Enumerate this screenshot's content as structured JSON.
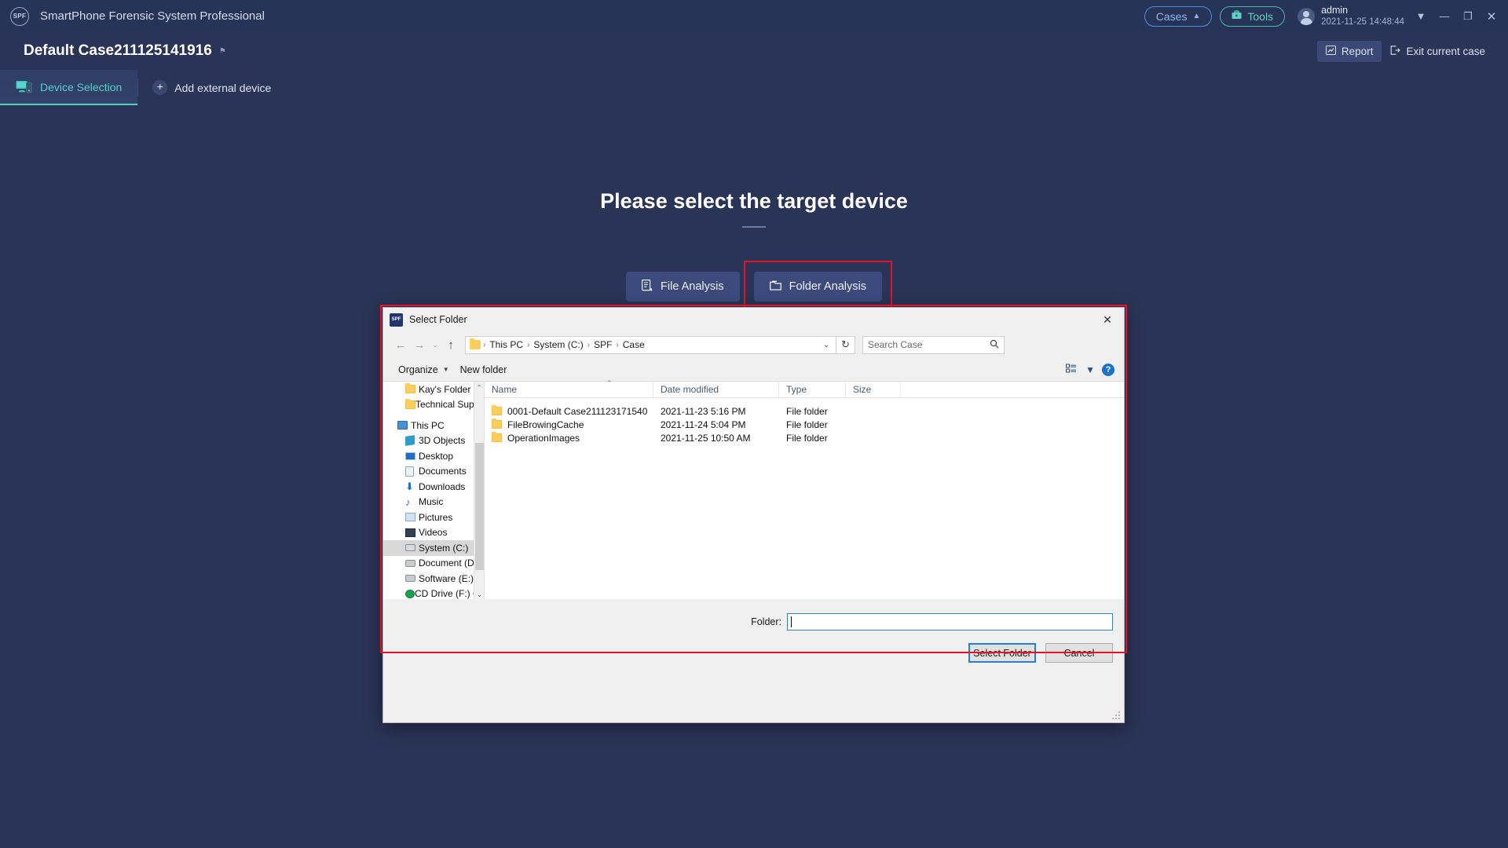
{
  "titlebar": {
    "logo_text": "SPF",
    "app_title": "SmartPhone Forensic System Professional",
    "cases_label": "Cases",
    "cases_caret": "▲",
    "tools_label": "Tools",
    "tools_icon": "briefcase-icon",
    "user_name": "admin",
    "user_time": "2021-11-25 14:48:44",
    "dropdown_glyph": "▼",
    "minimize_glyph": "—",
    "restore_glyph": "❐",
    "close_glyph": "✕"
  },
  "casebar": {
    "case_title": "Default Case211125141916",
    "case_badge": "⚑",
    "report_label": "Report",
    "report_icon": "Ὄ8",
    "exit_label": "Exit current case"
  },
  "tabs": {
    "device_selection_label": "Device Selection",
    "add_device_label": "Add external device",
    "plus_glyph": "+"
  },
  "main": {
    "headline": "Please select the target device",
    "file_analysis_label": "File Analysis",
    "folder_analysis_label": "Folder Analysis"
  },
  "dialog": {
    "title": "Select Folder",
    "close_glyph": "✕",
    "nav": {
      "back_glyph": "←",
      "forward_glyph": "→",
      "recent_glyph": "⌄",
      "up_glyph": "↑",
      "breadcrumbs": [
        "This PC",
        "System (C:)",
        "SPF",
        "Case"
      ],
      "crumb_sep": "›",
      "address_caret": "⌄",
      "refresh_glyph": "↻",
      "search_placeholder": "Search Case",
      "search_value": "",
      "search_icon": "⚲"
    },
    "commandbar": {
      "organize_label": "Organize",
      "organize_caret": "▼",
      "new_folder_label": "New folder",
      "view_icon": "view-options-icon",
      "view_caret": "▼",
      "help_label": "?"
    },
    "tree": {
      "pinned": [
        {
          "label": "Kay's Folder",
          "icon": "folder-icon",
          "pinned": true
        },
        {
          "label": "Technical Supp",
          "icon": "folder-icon",
          "pinned": true
        }
      ],
      "this_pc_label": "This PC",
      "items": [
        {
          "label": "3D Objects",
          "icon": "3d-objects-icon"
        },
        {
          "label": "Desktop",
          "icon": "desktop-icon"
        },
        {
          "label": "Documents",
          "icon": "documents-icon"
        },
        {
          "label": "Downloads",
          "icon": "downloads-icon"
        },
        {
          "label": "Music",
          "icon": "music-icon"
        },
        {
          "label": "Pictures",
          "icon": "pictures-icon"
        },
        {
          "label": "Videos",
          "icon": "videos-icon"
        },
        {
          "label": "System (C:)",
          "icon": "drive-icon",
          "selected": true
        },
        {
          "label": "Document (D:)",
          "icon": "drive-icon"
        },
        {
          "label": "Software (E:)",
          "icon": "drive-icon"
        },
        {
          "label": "CD Drive (F:) OPP",
          "icon": "cd-drive-icon"
        }
      ],
      "scroll_up_glyph": "⌃",
      "scroll_down_glyph": "⌄"
    },
    "filelist": {
      "columns": [
        "Name",
        "Date modified",
        "Type",
        "Size"
      ],
      "sort_caret": "⌃",
      "rows": [
        {
          "name": "0001-Default Case211123171540",
          "date": "2021-11-23 5:16 PM",
          "type": "File folder",
          "size": ""
        },
        {
          "name": "FileBrowingCache",
          "date": "2021-11-24 5:04 PM",
          "type": "File folder",
          "size": ""
        },
        {
          "name": "OperationImages",
          "date": "2021-11-25 10:50 AM",
          "type": "File folder",
          "size": ""
        }
      ]
    },
    "footer": {
      "folder_label": "Folder:",
      "folder_value": "",
      "select_label": "Select Folder",
      "cancel_label": "Cancel"
    }
  },
  "colors": {
    "app_bg": "#2a3456",
    "titlebar_bg": "#283358",
    "accent_teal": "#54cfc4",
    "accent_blue": "#4a8fe0",
    "highlight_red": "#e3142a",
    "button_blue": "#3c4b7c"
  }
}
